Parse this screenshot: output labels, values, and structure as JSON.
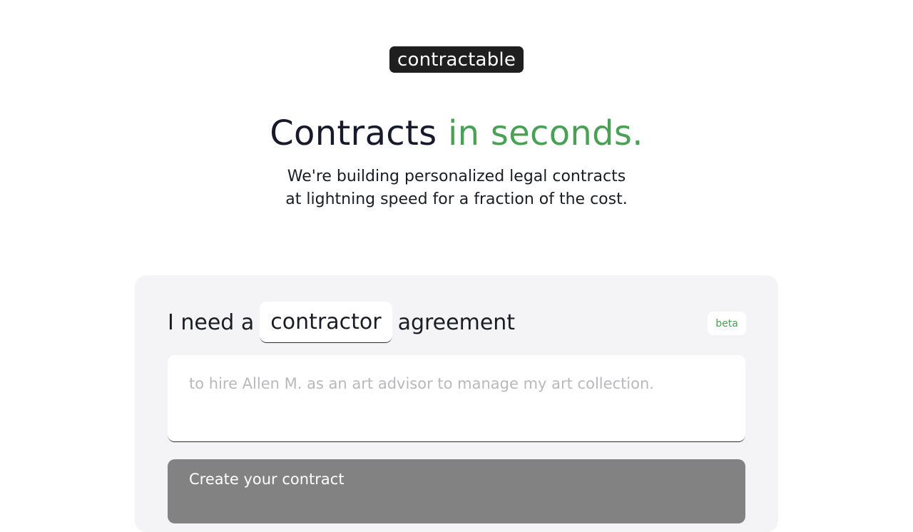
{
  "brand": {
    "logo_text": "contractable"
  },
  "hero": {
    "title_part1": "Contracts",
    "title_part2": "in seconds.",
    "subtitle_line1": "We're building personalized legal contracts",
    "subtitle_line2": "at lightning speed for a fraction of the cost.",
    "accent_color": "#48a155"
  },
  "form": {
    "prefix": "I need a",
    "contract_type": "contractor",
    "suffix": "agreement",
    "badge": "beta",
    "description_placeholder": "to hire Allen M. as an art advisor to manage my art collection.",
    "description_value": "",
    "submit_label": "Create your contract"
  }
}
